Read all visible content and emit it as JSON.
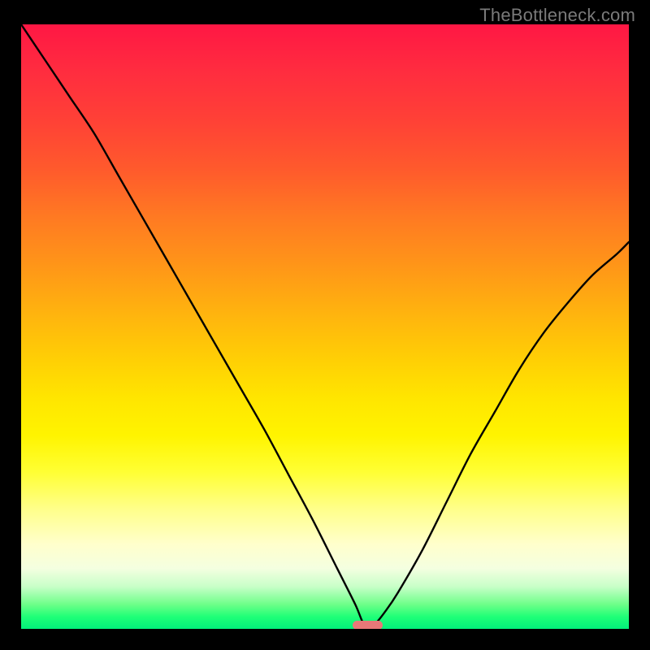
{
  "attribution": "TheBottleneck.com",
  "chart_data": {
    "type": "line",
    "title": "",
    "xlabel": "",
    "ylabel": "",
    "xlim": [
      0,
      100
    ],
    "ylim": [
      0,
      100
    ],
    "series": [
      {
        "name": "bottleneck-curve",
        "x": [
          0,
          4,
          8,
          12,
          16,
          20,
          24,
          28,
          32,
          36,
          40,
          44,
          48,
          52,
          55,
          56.5,
          58,
          60,
          62,
          66,
          70,
          74,
          78,
          82,
          86,
          90,
          94,
          98,
          100
        ],
        "values": [
          100,
          94,
          88,
          82,
          75,
          68,
          61,
          54,
          47,
          40,
          33,
          25.5,
          18,
          10,
          4,
          0.6,
          0.6,
          3,
          6,
          13,
          21,
          29,
          36,
          43,
          49,
          54,
          58.5,
          62,
          64
        ]
      }
    ],
    "marker": {
      "x_center": 57,
      "x_halfwidth": 2.5,
      "y": 0.6
    },
    "annotations": [],
    "colors": {
      "curve": "#000000",
      "marker": "#e87878",
      "gradient_top": "#ff1744",
      "gradient_bottom": "#02f07a"
    }
  }
}
